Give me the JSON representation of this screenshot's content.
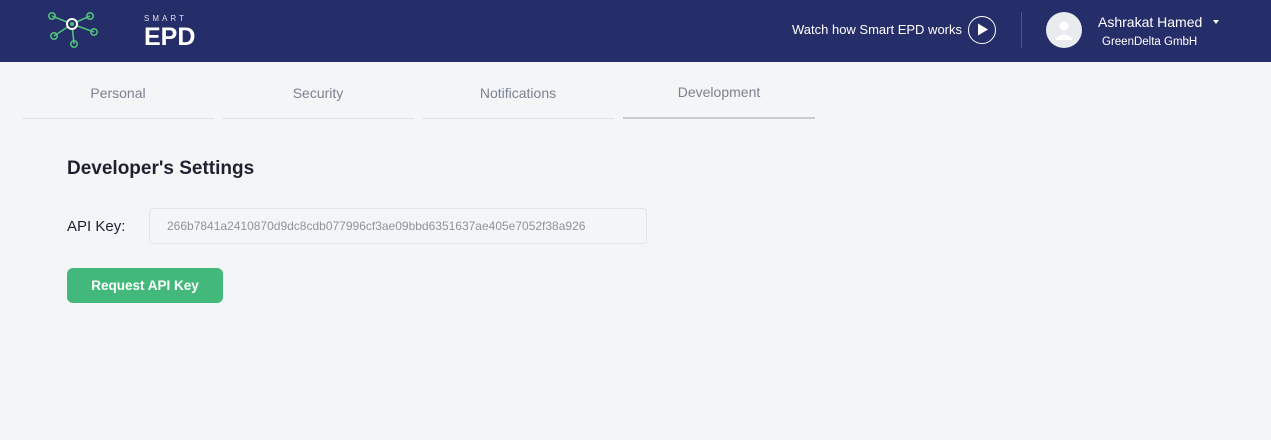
{
  "header": {
    "logo_small": "SMART",
    "logo_big": "EPD",
    "watch_text": "Watch how Smart EPD works",
    "play_icon": "play-icon",
    "user": {
      "name": "Ashrakat Hamed",
      "organization": "GreenDelta GmbH",
      "avatar_icon": "user-avatar-icon",
      "dropdown_icon": "caret-down-icon"
    }
  },
  "tabs": [
    {
      "label": "Personal",
      "active": false
    },
    {
      "label": "Security",
      "active": false
    },
    {
      "label": "Notifications",
      "active": false
    },
    {
      "label": "Development",
      "active": true
    }
  ],
  "developer": {
    "title": "Developer's Settings",
    "api_key_label": "API Key:",
    "api_key_value": "266b7841a2410870d9dc8cdb077996cf3ae09bbd6351637ae405e7052f38a926",
    "request_button": "Request API Key"
  },
  "colors": {
    "header_bg": "#262e6a",
    "page_bg": "#f4f5f7",
    "accent_green": "#42b97b",
    "logo_green": "#4fbf7a"
  }
}
